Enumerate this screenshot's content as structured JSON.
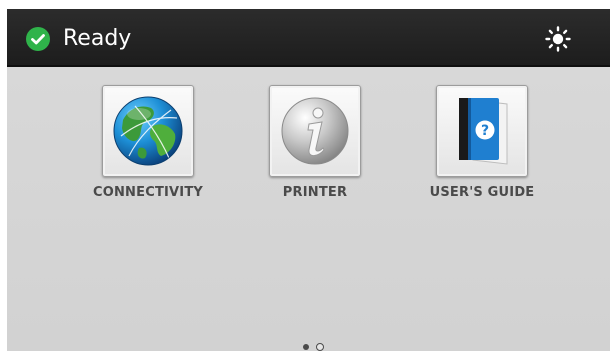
{
  "status_bar": {
    "status_text": "Ready",
    "status_icon": "check-circle-icon",
    "status_color": "#2fb34a",
    "brightness_icon": "brightness-icon"
  },
  "apps": [
    {
      "label": "CONNECTIVITY",
      "icon": "globe-icon"
    },
    {
      "label": "PRINTER",
      "icon": "info-icon"
    },
    {
      "label": "USER'S GUIDE",
      "icon": "guide-book-icon"
    }
  ],
  "pager": {
    "page_count": 2,
    "current_page": 1
  }
}
